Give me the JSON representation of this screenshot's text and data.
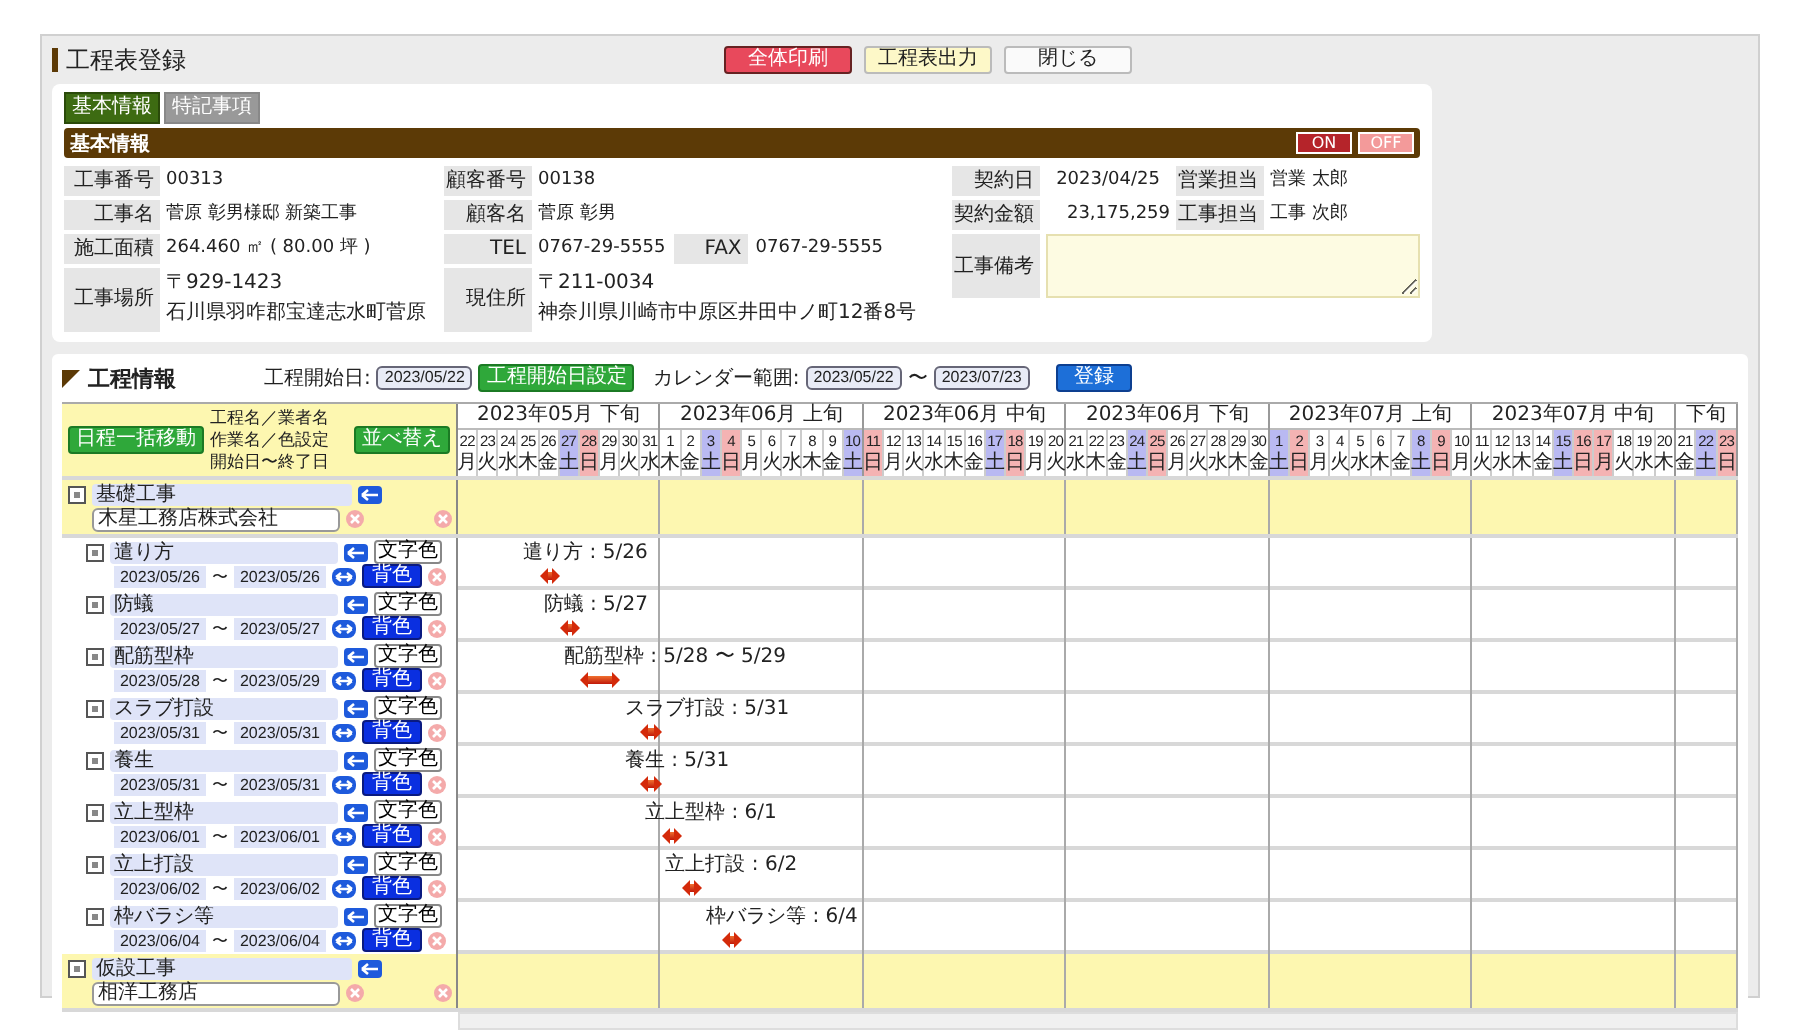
{
  "header": {
    "title": "工程表登録",
    "buttons": [
      {
        "label": "全体印刷",
        "kind": "print"
      },
      {
        "label": "工程表出力",
        "kind": "export"
      },
      {
        "label": "閉じる",
        "kind": "close"
      }
    ]
  },
  "tabs": [
    {
      "label": "基本情報",
      "selected": true
    },
    {
      "label": "特記事項",
      "selected": false
    }
  ],
  "section": {
    "title": "基本情報",
    "toggle": [
      {
        "label": "ON",
        "selected": true
      },
      {
        "label": "OFF",
        "selected": false
      }
    ]
  },
  "info": {
    "construction_number": {
      "label": "工事番号",
      "value": "00313"
    },
    "customer_number": {
      "label": "顧客番号",
      "value": "00138"
    },
    "contract_date": {
      "label": "契約日",
      "value": "2023/04/25"
    },
    "sales_rep": {
      "label": "営業担当",
      "value": "営業 太郎"
    },
    "construction_name": {
      "label": "工事名",
      "value": "菅原 彰男様邸 新築工事"
    },
    "customer_name": {
      "label": "顧客名",
      "value": "菅原 彰男"
    },
    "contract_amount": {
      "label": "契約金額",
      "value": "23,175,259"
    },
    "construction_rep": {
      "label": "工事担当",
      "value": "工事 次郎"
    },
    "floor_area": {
      "label": "施工面積",
      "value": "264.460 ㎡ ( 80.00 坪 )"
    },
    "tel": {
      "label": "TEL",
      "value": "0767-29-5555"
    },
    "fax": {
      "label": "FAX",
      "value": "0767-29-5555"
    },
    "site": {
      "label": "工事場所",
      "lines": [
        "〒929-1423",
        "石川県羽咋郡宝達志水町菅原"
      ]
    },
    "address": {
      "label": "現住所",
      "lines": [
        "〒211-0034",
        "神奈川県川崎市中原区井田中ノ町12番8号"
      ]
    },
    "memo": {
      "label": "工事備考"
    }
  },
  "gantt": {
    "title": "工程情報",
    "start_label": "工程開始日:",
    "start_date": "2023/05/22",
    "set_start_button": "工程開始日設定",
    "range_label": "カレンダー範囲:",
    "range_from": "2023/05/22",
    "range_sep": "〜",
    "range_to": "2023/07/23",
    "register_button": "登録",
    "bulk_move_button": "日程一括移動",
    "caption": [
      "工程名／業者名",
      "作業名／色設定",
      "開始日〜終了日"
    ],
    "sort_button": "並べ替え",
    "periods": [
      {
        "label": "2023年05月 下旬",
        "days": [
          {
            "d": "22",
            "w": "月",
            "kind": "weekday"
          },
          {
            "d": "23",
            "w": "火",
            "kind": "weekday"
          },
          {
            "d": "24",
            "w": "水",
            "kind": "weekday"
          },
          {
            "d": "25",
            "w": "木",
            "kind": "weekday"
          },
          {
            "d": "26",
            "w": "金",
            "kind": "weekday"
          },
          {
            "d": "27",
            "w": "土",
            "kind": "saturday"
          },
          {
            "d": "28",
            "w": "日",
            "kind": "holiday"
          },
          {
            "d": "29",
            "w": "月",
            "kind": "weekday"
          },
          {
            "d": "30",
            "w": "火",
            "kind": "weekday"
          },
          {
            "d": "31",
            "w": "水",
            "kind": "weekday"
          }
        ]
      },
      {
        "label": "2023年06月 上旬",
        "days": [
          {
            "d": "1",
            "w": "木",
            "kind": "weekday"
          },
          {
            "d": "2",
            "w": "金",
            "kind": "weekday"
          },
          {
            "d": "3",
            "w": "土",
            "kind": "saturday"
          },
          {
            "d": "4",
            "w": "日",
            "kind": "holiday"
          },
          {
            "d": "5",
            "w": "月",
            "kind": "weekday"
          },
          {
            "d": "6",
            "w": "火",
            "kind": "weekday"
          },
          {
            "d": "7",
            "w": "水",
            "kind": "weekday"
          },
          {
            "d": "8",
            "w": "木",
            "kind": "weekday"
          },
          {
            "d": "9",
            "w": "金",
            "kind": "weekday"
          },
          {
            "d": "10",
            "w": "土",
            "kind": "saturday"
          }
        ]
      },
      {
        "label": "2023年06月 中旬",
        "days": [
          {
            "d": "11",
            "w": "日",
            "kind": "holiday"
          },
          {
            "d": "12",
            "w": "月",
            "kind": "weekday"
          },
          {
            "d": "13",
            "w": "火",
            "kind": "weekday"
          },
          {
            "d": "14",
            "w": "水",
            "kind": "weekday"
          },
          {
            "d": "15",
            "w": "木",
            "kind": "weekday"
          },
          {
            "d": "16",
            "w": "金",
            "kind": "weekday"
          },
          {
            "d": "17",
            "w": "土",
            "kind": "saturday"
          },
          {
            "d": "18",
            "w": "日",
            "kind": "holiday"
          },
          {
            "d": "19",
            "w": "月",
            "kind": "weekday"
          },
          {
            "d": "20",
            "w": "火",
            "kind": "weekday"
          }
        ]
      },
      {
        "label": "2023年06月 下旬",
        "days": [
          {
            "d": "21",
            "w": "水",
            "kind": "weekday"
          },
          {
            "d": "22",
            "w": "木",
            "kind": "weekday"
          },
          {
            "d": "23",
            "w": "金",
            "kind": "weekday"
          },
          {
            "d": "24",
            "w": "土",
            "kind": "saturday"
          },
          {
            "d": "25",
            "w": "日",
            "kind": "holiday"
          },
          {
            "d": "26",
            "w": "月",
            "kind": "weekday"
          },
          {
            "d": "27",
            "w": "火",
            "kind": "weekday"
          },
          {
            "d": "28",
            "w": "水",
            "kind": "weekday"
          },
          {
            "d": "29",
            "w": "木",
            "kind": "weekday"
          },
          {
            "d": "30",
            "w": "金",
            "kind": "weekday"
          }
        ]
      },
      {
        "label": "2023年07月 上旬",
        "days": [
          {
            "d": "1",
            "w": "土",
            "kind": "saturday"
          },
          {
            "d": "2",
            "w": "日",
            "kind": "holiday"
          },
          {
            "d": "3",
            "w": "月",
            "kind": "weekday"
          },
          {
            "d": "4",
            "w": "火",
            "kind": "weekday"
          },
          {
            "d": "5",
            "w": "水",
            "kind": "weekday"
          },
          {
            "d": "6",
            "w": "木",
            "kind": "weekday"
          },
          {
            "d": "7",
            "w": "金",
            "kind": "weekday"
          },
          {
            "d": "8",
            "w": "土",
            "kind": "saturday"
          },
          {
            "d": "9",
            "w": "日",
            "kind": "holiday"
          },
          {
            "d": "10",
            "w": "月",
            "kind": "weekday"
          }
        ]
      },
      {
        "label": "2023年07月 中旬",
        "days": [
          {
            "d": "11",
            "w": "火",
            "kind": "weekday"
          },
          {
            "d": "12",
            "w": "水",
            "kind": "weekday"
          },
          {
            "d": "13",
            "w": "木",
            "kind": "weekday"
          },
          {
            "d": "14",
            "w": "金",
            "kind": "weekday"
          },
          {
            "d": "15",
            "w": "土",
            "kind": "saturday"
          },
          {
            "d": "16",
            "w": "日",
            "kind": "holiday"
          },
          {
            "d": "17",
            "w": "月",
            "kind": "holiday"
          },
          {
            "d": "18",
            "w": "火",
            "kind": "weekday"
          },
          {
            "d": "19",
            "w": "水",
            "kind": "weekday"
          },
          {
            "d": "20",
            "w": "木",
            "kind": "weekday"
          }
        ]
      },
      {
        "label": "下旬",
        "days": [
          {
            "d": "21",
            "w": "金",
            "kind": "weekday"
          },
          {
            "d": "22",
            "w": "土",
            "kind": "saturday"
          },
          {
            "d": "23",
            "w": "日",
            "kind": "holiday"
          }
        ]
      }
    ],
    "groups": [
      {
        "name": "基礎工事",
        "company": "木星工務店株式会社",
        "tasks": [
          {
            "name": "遣り方",
            "start": "2023/05/26",
            "sep": "〜",
            "end": "2023/05/26",
            "text_color_button": "文字色",
            "bg_color_button": "背色",
            "bar_label": "遣り方 : 5/26"
          },
          {
            "name": "防蟻",
            "start": "2023/05/27",
            "sep": "〜",
            "end": "2023/05/27",
            "text_color_button": "文字色",
            "bg_color_button": "背色",
            "bar_label": "防蟻 : 5/27"
          },
          {
            "name": "配筋型枠",
            "start": "2023/05/28",
            "sep": "〜",
            "end": "2023/05/29",
            "text_color_button": "文字色",
            "bg_color_button": "背色",
            "bar_label": "配筋型枠 : 5/28 〜 5/29"
          },
          {
            "name": "スラブ打設",
            "start": "2023/05/31",
            "sep": "〜",
            "end": "2023/05/31",
            "text_color_button": "文字色",
            "bg_color_button": "背色",
            "bar_label": "スラブ打設 : 5/31"
          },
          {
            "name": "養生",
            "start": "2023/05/31",
            "sep": "〜",
            "end": "2023/05/31",
            "text_color_button": "文字色",
            "bg_color_button": "背色",
            "bar_label": "養生 : 5/31"
          },
          {
            "name": "立上型枠",
            "start": "2023/06/01",
            "sep": "〜",
            "end": "2023/06/01",
            "text_color_button": "文字色",
            "bg_color_button": "背色",
            "bar_label": "立上型枠 : 6/1"
          },
          {
            "name": "立上打設",
            "start": "2023/06/02",
            "sep": "〜",
            "end": "2023/06/02",
            "text_color_button": "文字色",
            "bg_color_button": "背色",
            "bar_label": "立上打設 : 6/2"
          },
          {
            "name": "枠バラシ等",
            "start": "2023/06/04",
            "sep": "〜",
            "end": "2023/06/04",
            "text_color_button": "文字色",
            "bg_color_button": "背色",
            "bar_label": "枠バラシ等 : 6/4"
          }
        ]
      },
      {
        "name": "仮設工事",
        "company": "相洋工務店"
      }
    ]
  }
}
